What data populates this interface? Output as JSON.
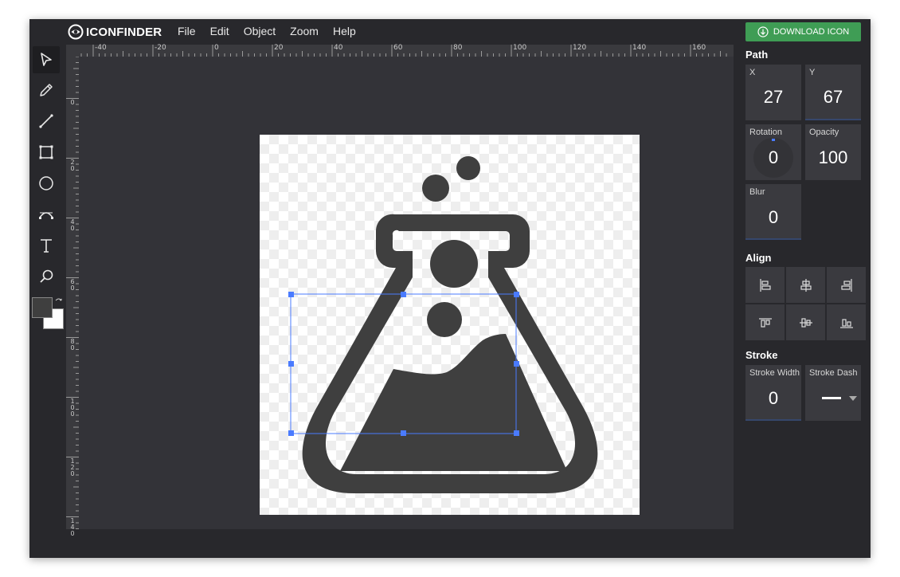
{
  "app": {
    "logo_text": "ICONFINDER",
    "menu": [
      "File",
      "Edit",
      "Object",
      "Zoom",
      "Help"
    ]
  },
  "toolbar": {
    "tools": [
      "select-tool",
      "pencil-tool",
      "line-tool",
      "rectangle-tool",
      "ellipse-tool",
      "path-tool",
      "text-tool",
      "zoom-tool"
    ],
    "active": "select-tool",
    "fill_color": "#3f3f3f",
    "stroke_color": "#ffffff"
  },
  "rulers": {
    "top": [
      "-40",
      "-20",
      "0",
      "20",
      "40",
      "60",
      "80",
      "100",
      "120",
      "140",
      "160"
    ],
    "left": [
      "0",
      "20",
      "40",
      "60",
      "80",
      "100",
      "120",
      "140"
    ]
  },
  "panel": {
    "download_label": "DOWNLOAD ICON",
    "path_title": "Path",
    "x_label": "X",
    "x_value": "27",
    "y_label": "Y",
    "y_value": "67",
    "rotation_label": "Rotation",
    "rotation_value": "0",
    "opacity_label": "Opacity",
    "opacity_value": "100",
    "blur_label": "Blur",
    "blur_value": "0",
    "align_title": "Align",
    "stroke_title": "Stroke",
    "stroke_width_label": "Stroke Width",
    "stroke_width_value": "0",
    "stroke_dash_label": "Stroke Dash"
  },
  "colors": {
    "accent": "#3f9d55",
    "selection": "#4a7bff",
    "icon_fill": "#3f3f3f",
    "background": "#28282c",
    "workspace": "#333338"
  }
}
